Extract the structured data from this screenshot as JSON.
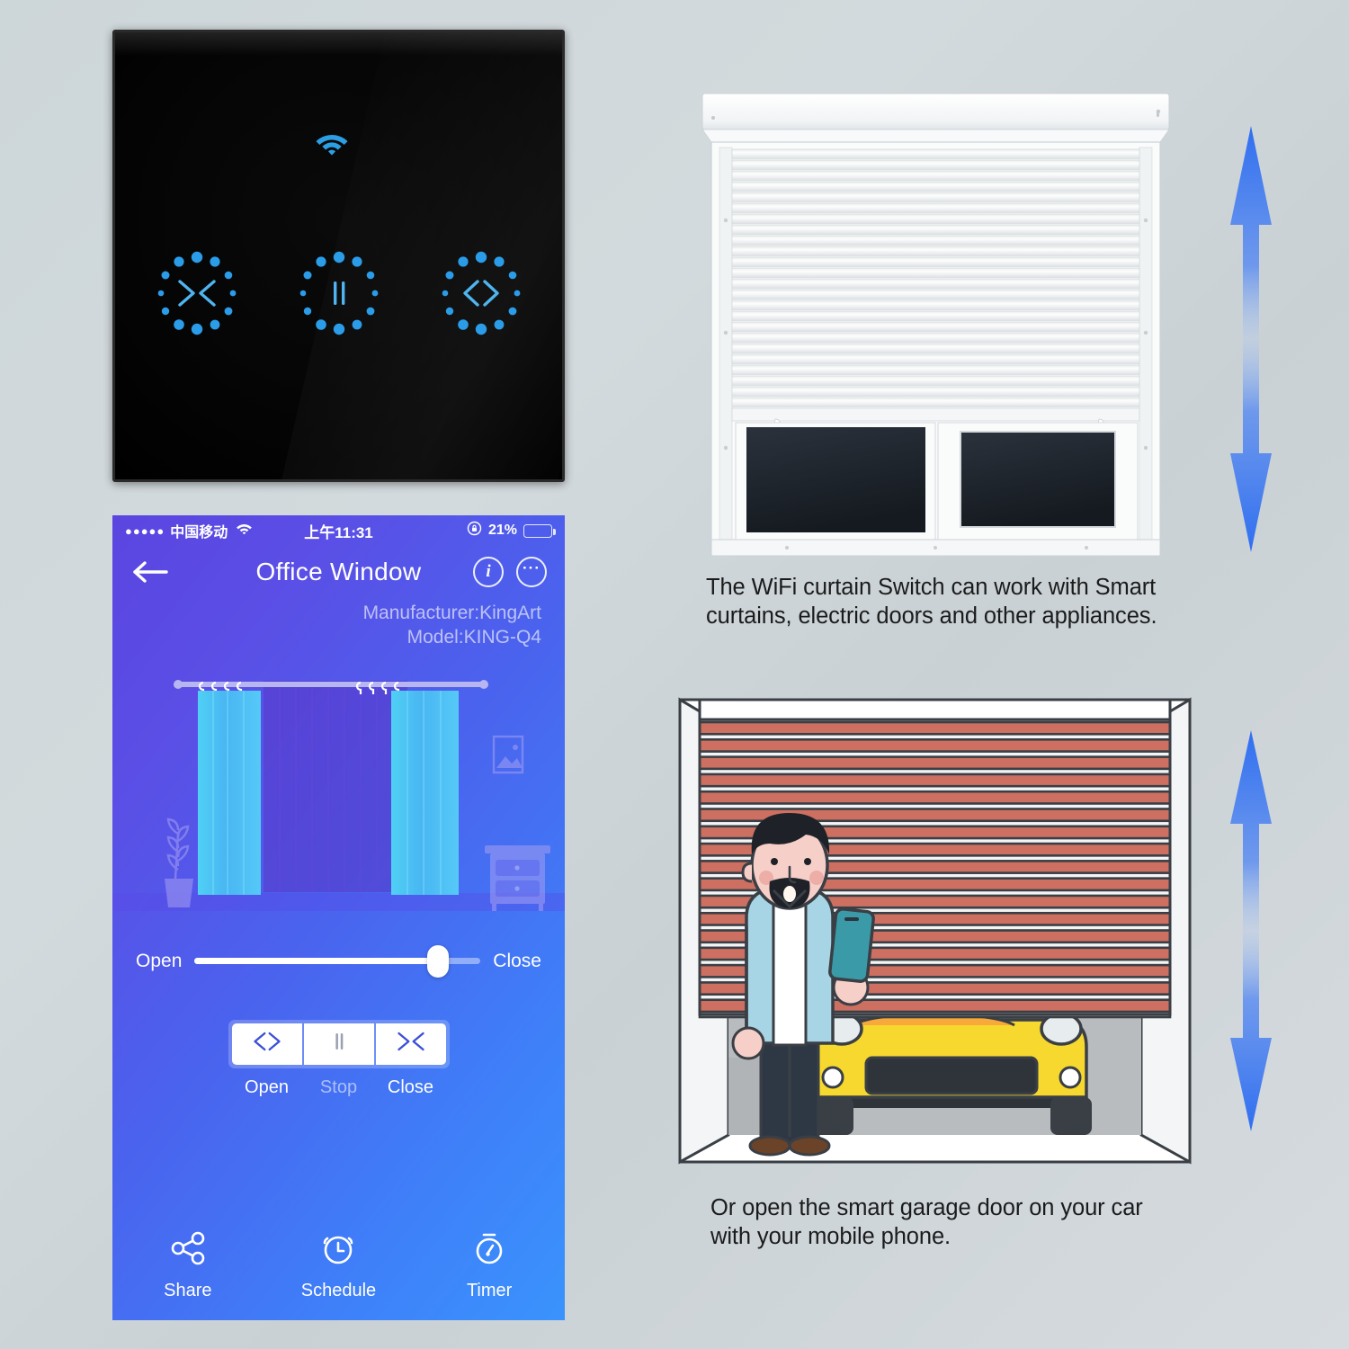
{
  "background": {
    "color_top_left": "#cdd6d9",
    "color_bottom_right": "#d6dbdf"
  },
  "switch_panel": {
    "name": "WiFi Touch Curtain Switch",
    "body_color": "#000000",
    "indicator_color": "#2aa3e8",
    "wifi_icon": "wifi-icon",
    "buttons": [
      {
        "id": "close",
        "glyph": "><",
        "icon_name": "close-curtain-icon",
        "label": "Close"
      },
      {
        "id": "stop",
        "glyph": "||",
        "icon_name": "stop-icon",
        "label": "Stop"
      },
      {
        "id": "open",
        "glyph": "<>",
        "icon_name": "open-curtain-icon",
        "label": "Open"
      }
    ]
  },
  "phone": {
    "status_bar": {
      "signal_dots": "●●●●●",
      "carrier": "中国移动",
      "wifi_icon": "wifi-icon",
      "time": "上午11:31",
      "rotation_lock_icon": "rotation-lock-icon",
      "battery_percent": "21%",
      "battery_level": 21
    },
    "navbar": {
      "back_icon": "back-arrow-icon",
      "title": "Office Window",
      "info_label": "i",
      "more_label": "···"
    },
    "device_info": {
      "manufacturer": "Manufacturer:KingArt",
      "model": "Model:KING-Q4"
    },
    "scene": {
      "curtain_rod": "curtain-rod",
      "left_panel": "curtain-panel-left",
      "right_panel": "curtain-panel-right",
      "plant_icon": "potted-plant-icon",
      "picture_frame_icon": "picture-frame-icon",
      "nightstand_icon": "nightstand-icon"
    },
    "slider": {
      "left_label": "Open",
      "right_label": "Close",
      "value_percent": 85
    },
    "controls": [
      {
        "id": "open",
        "glyph": "<>",
        "icon_name": "open-curtain-icon",
        "label": "Open",
        "dim": false
      },
      {
        "id": "stop",
        "glyph": "||",
        "icon_name": "stop-icon",
        "label": "Stop",
        "dim": true
      },
      {
        "id": "close",
        "glyph": "><",
        "icon_name": "close-curtain-icon",
        "label": "Close",
        "dim": false
      }
    ],
    "bottom_nav": [
      {
        "id": "share",
        "label": "Share",
        "icon_name": "share-network-icon"
      },
      {
        "id": "schedule",
        "label": "Schedule",
        "icon_name": "alarm-clock-icon"
      },
      {
        "id": "timer",
        "label": "Timer",
        "icon_name": "stopwatch-icon"
      }
    ],
    "gradient_start": "#5b45e0",
    "gradient_end": "#3a93fd"
  },
  "right_column": {
    "shutter_window": {
      "name": "roller-shutter-window",
      "slat_count": 24,
      "pane_color": "#222a33",
      "frame_color": "#ffffff"
    },
    "caption_1": "The WiFi curtain Switch can work with Smart curtains, electric doors and other appliances.",
    "garage": {
      "name": "garage-door-illustration",
      "shutter_color": "#cd6f61",
      "car_color": "#f7d82e",
      "person_jacket_color": "#a8d5e5",
      "phone_color": "#3b9aa8"
    },
    "caption_2": "Or open the smart garage door on your car with your mobile phone.",
    "arrow_color": "#2f6ef0",
    "arrow_icon": "double-arrow-vertical-icon"
  }
}
